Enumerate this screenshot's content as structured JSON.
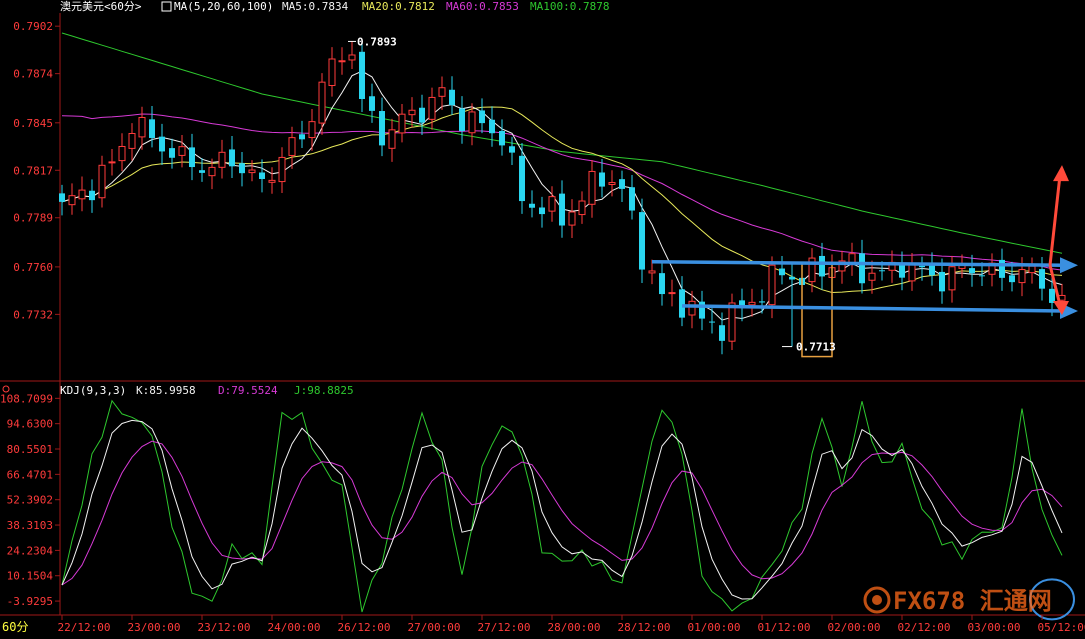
{
  "colors": {
    "background": "#000000",
    "axis": "#a01818",
    "axis_text": "#ff3b3b",
    "label_text": "#ffffff",
    "up_candle": "#ff3b3b",
    "down_candle": "#2ad6f0",
    "ma5": "#f2f2f2",
    "ma20": "#e7e85a",
    "ma60": "#d73ad6",
    "ma100": "#2ec82e",
    "k_line": "#f2f2f2",
    "d_line": "#d73ad6",
    "j_line": "#2ec82e",
    "annotation_blue": "#3a8fe0",
    "annotation_red": "#ff4a3a",
    "highlight_box": "#e8a040"
  },
  "price_panel": {
    "title": "澳元美元<60分>",
    "ma_label": "MA(5,20,60,100)",
    "ma5_label": "MA5:0.7834",
    "ma20_label": "MA20:0.7812",
    "ma60_label": "MA60:0.7853",
    "ma100_label": "MA100:0.7878",
    "high_label": "0.7893",
    "low_label": "0.7713"
  },
  "kdj_panel": {
    "indicator_label": "KDJ(9,3,3)",
    "k_label": "K:85.9958",
    "d_label": "D:79.5524",
    "j_label": "J:98.8825"
  },
  "period_label": "60分",
  "watermark": "FX678 汇通网",
  "chart_data": [
    {
      "type": "candlestick",
      "title": "澳元美元<60分>",
      "ylim": [
        0.7698,
        0.7908
      ],
      "y_ticks": [
        "0.7902",
        "0.7874",
        "0.7845",
        "0.7817",
        "0.7789",
        "0.7760",
        "0.7732"
      ],
      "x_ticks": [
        "22/12:00",
        "23/00:00",
        "23/12:00",
        "24/00:00",
        "26/12:00",
        "27/00:00",
        "27/12:00",
        "28/00:00",
        "28/12:00",
        "01/00:00",
        "01/12:00",
        "02/00:00",
        "02/12:00",
        "03/00:00",
        "05/12:00"
      ],
      "x_tick_index": [
        0,
        7,
        14,
        21,
        28,
        35,
        42,
        49,
        56,
        63,
        70,
        77,
        84,
        91,
        98
      ],
      "close_anchors": {
        "index": [
          0,
          3,
          5,
          7,
          9,
          12,
          15,
          17,
          20,
          22,
          24,
          26,
          28,
          30,
          32,
          34,
          36,
          38,
          40,
          42,
          44,
          46,
          48,
          50,
          52,
          54,
          56,
          58,
          60,
          62,
          64,
          66,
          68,
          70,
          72,
          74,
          76,
          78,
          80,
          82,
          84,
          86,
          88,
          90,
          92,
          94,
          96,
          98,
          100
        ],
        "close": [
          0.7795,
          0.7808,
          0.782,
          0.7845,
          0.7836,
          0.7823,
          0.7818,
          0.7824,
          0.7808,
          0.7826,
          0.7835,
          0.7868,
          0.7885,
          0.7856,
          0.7838,
          0.7846,
          0.7853,
          0.7862,
          0.7848,
          0.7843,
          0.7838,
          0.78,
          0.7795,
          0.7789,
          0.78,
          0.7815,
          0.7805,
          0.7768,
          0.7742,
          0.774,
          0.7728,
          0.7725,
          0.7736,
          0.7745,
          0.7758,
          0.7752,
          0.776,
          0.7763,
          0.7758,
          0.7755,
          0.7762,
          0.7756,
          0.7753,
          0.7758,
          0.776,
          0.7752,
          0.776,
          0.7748,
          0.7741
        ]
      },
      "high_marker": {
        "index": 29,
        "value": 0.7893
      },
      "low_marker": {
        "index": 73,
        "value": 0.7713
      },
      "moving_averages": [
        {
          "name": "MA5",
          "color": "#f2f2f2",
          "last": 0.7834
        },
        {
          "name": "MA20",
          "color": "#e7e85a",
          "last": 0.7812
        },
        {
          "name": "MA60",
          "color": "#d73ad6",
          "last": 0.7853
        },
        {
          "name": "MA100",
          "color": "#2ec82e",
          "last": 0.7878
        }
      ],
      "ma100_anchors": {
        "index": [
          0,
          10,
          20,
          30,
          40,
          50,
          60,
          70,
          80,
          90,
          100
        ],
        "value": [
          0.7898,
          0.788,
          0.7862,
          0.785,
          0.7838,
          0.7828,
          0.7822,
          0.7808,
          0.7793,
          0.778,
          0.7768
        ]
      },
      "annotations": {
        "resistance_line": {
          "from": [
            59,
            0.7763
          ],
          "to": [
            101,
            0.7761
          ]
        },
        "support_line": {
          "from": [
            62,
            0.7737
          ],
          "to": [
            101,
            0.7734
          ]
        },
        "highlight_box": {
          "index": [
            74,
            77
          ],
          "value": [
            0.7713,
            0.7762
          ]
        }
      }
    },
    {
      "type": "line",
      "title": "KDJ(9,3,3)",
      "ylim": [
        -10,
        110
      ],
      "y_ticks": [
        "108.7099",
        "94.6300",
        "80.5501",
        "66.4701",
        "52.3902",
        "38.3103",
        "24.2304",
        "10.1504",
        "-3.9295"
      ],
      "series": [
        {
          "name": "K",
          "color": "#f2f2f2",
          "last": 85.9958
        },
        {
          "name": "D",
          "color": "#d73ad6",
          "last": 79.5524
        },
        {
          "name": "J",
          "color": "#2ec82e",
          "last": 98.8825
        }
      ],
      "j_anchors": {
        "index": [
          0,
          3,
          5,
          7,
          9,
          11,
          13,
          15,
          17,
          20,
          22,
          24,
          26,
          28,
          30,
          32,
          34,
          36,
          38,
          40,
          42,
          44,
          46,
          48,
          50,
          52,
          54,
          56,
          58,
          60,
          62,
          64,
          66,
          68,
          70,
          72,
          74,
          76,
          78,
          80,
          82,
          84,
          86,
          88,
          90,
          92,
          94,
          96,
          98,
          100
        ],
        "value": [
          5,
          75,
          105,
          98,
          90,
          40,
          2,
          -5,
          25,
          18,
          100,
          98,
          70,
          60,
          -10,
          20,
          60,
          100,
          72,
          8,
          70,
          95,
          80,
          25,
          18,
          22,
          15,
          5,
          60,
          105,
          80,
          10,
          -5,
          -8,
          8,
          25,
          50,
          100,
          60,
          105,
          70,
          82,
          48,
          30,
          22,
          35,
          35,
          100,
          45,
          22
        ]
      }
    }
  ]
}
